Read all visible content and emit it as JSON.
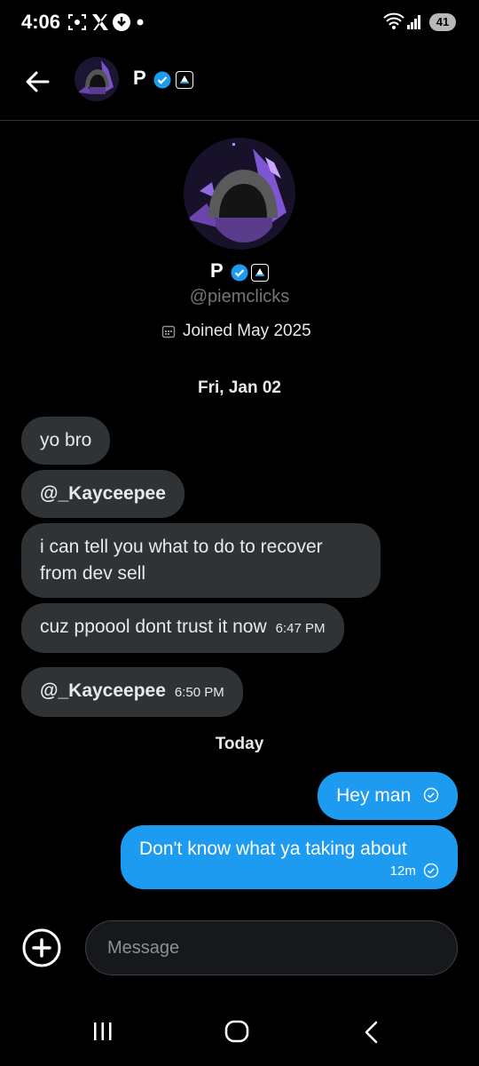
{
  "status_bar": {
    "time": "4:06",
    "battery": "41"
  },
  "header": {
    "name": "P"
  },
  "profile": {
    "name": "P",
    "handle": "@piemclicks",
    "joined": "Joined May 2025"
  },
  "conversation": {
    "date_1": "Fri, Jan 02",
    "incoming": [
      {
        "text": "yo bro",
        "time": ""
      },
      {
        "text": "@_Kayceepee",
        "time": ""
      },
      {
        "text_line1": "i can tell you what to do to recover",
        "text_line2": "from dev sell",
        "time": ""
      },
      {
        "text": "cuz ppoool dont trust it now",
        "time": "6:47 PM"
      },
      {
        "text": "@_Kayceepee",
        "time": "6:50 PM"
      }
    ],
    "date_2": "Today",
    "outgoing": [
      {
        "text": "Hey man",
        "time": ""
      },
      {
        "text": "Don't know what ya taking about",
        "time": "12m"
      }
    ]
  },
  "composer": {
    "placeholder": "Message"
  },
  "colors": {
    "accent": "#1d9bf0",
    "incoming_bubble": "#2f3336",
    "background": "#000000"
  },
  "icons": [
    "back-arrow-icon",
    "verified-badge-icon",
    "affiliate-badge-icon",
    "calendar-icon",
    "sent-check-icon",
    "add-icon",
    "recent-apps-icon",
    "home-icon",
    "back-nav-icon"
  ]
}
